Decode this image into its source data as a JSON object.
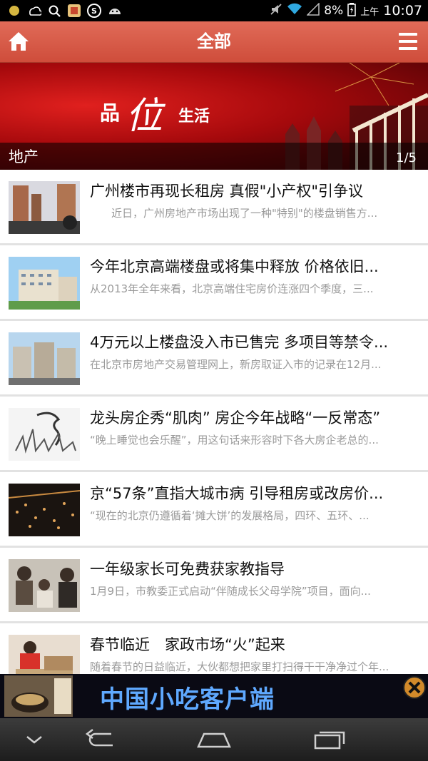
{
  "status_bar": {
    "battery": "8%",
    "ampm": "上午",
    "time": "10:07"
  },
  "header": {
    "title": "全部",
    "home_icon": "home-icon",
    "menu_icon": "menu-icon"
  },
  "banner": {
    "caption": "地产",
    "counter": "1/5",
    "logo_text": "品位生活"
  },
  "articles": [
    {
      "title": "广州楼市再现长租房 真假\"小产权\"引争议",
      "summary": "　　近日，广州房地产市场出现了一种\"特别\"的楼盘销售方..."
    },
    {
      "title": "今年北京高端楼盘或将集中释放 价格依旧...",
      "summary": "从2013年全年来看，北京高端住宅房价连涨四个季度，三..."
    },
    {
      "title": "4万元以上楼盘没入市已售完 多项目等禁令...",
      "summary": "在北京市房地产交易管理网上，新房取证入市的记录在12月..."
    },
    {
      "title": "龙头房企秀“肌肉” 房企今年战略“一反常态”",
      "summary": "“晚上睡觉也会乐醒”，用这句话来形容时下各大房企老总的..."
    },
    {
      "title": "京“57条”直指大城市病 引导租房或改房价...",
      "summary": "“现在的北京仍遵循着‘摊大饼’的发展格局，四环、五环、..."
    },
    {
      "title": "一年级家长可免费获家教指导",
      "summary": "1月9日，市教委正式启动“伴随成长父母学院”项目，面向..."
    },
    {
      "title": "春节临近　家政市场“火”起来",
      "summary": "随着春节的日益临近，大伙都想把家里打扫得干干净净过个年..."
    }
  ],
  "ad": {
    "text": "中国小吃客户端",
    "thumb_label": "中国小吃"
  },
  "colors": {
    "header": "#d45a47",
    "banner": "#b30d10",
    "title_text": "#111111",
    "summary_text": "#9a9a9a"
  }
}
